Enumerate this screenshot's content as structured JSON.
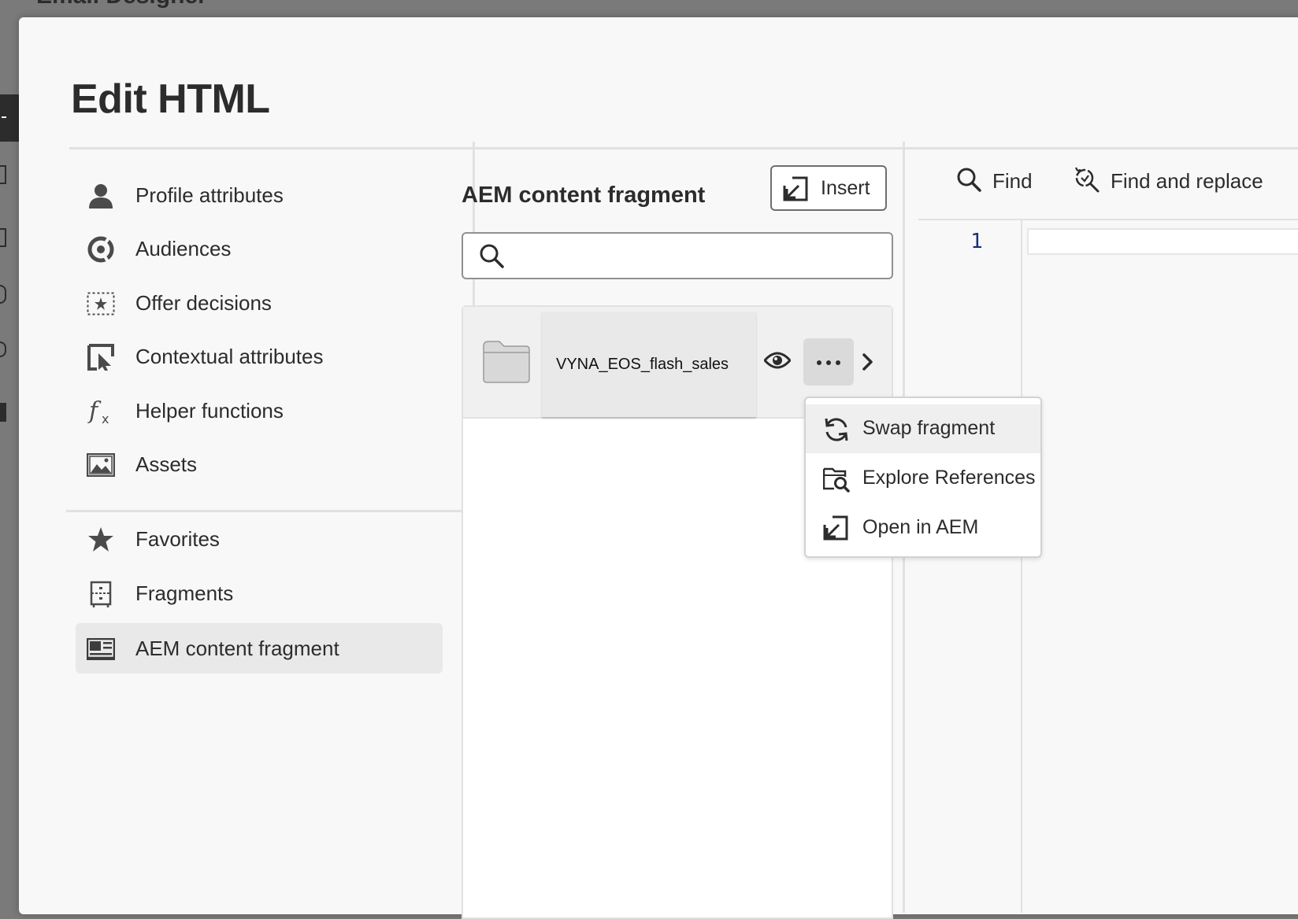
{
  "background": {
    "app_title": "Email Designer"
  },
  "modal": {
    "title": "Edit HTML"
  },
  "sidebar": {
    "items": [
      {
        "label": "Profile attributes",
        "icon": "user-icon",
        "selected": false
      },
      {
        "label": "Audiences",
        "icon": "audience-icon",
        "selected": false
      },
      {
        "label": "Offer decisions",
        "icon": "offer-icon",
        "selected": false
      },
      {
        "label": "Contextual attributes",
        "icon": "contextual-icon",
        "selected": false
      },
      {
        "label": "Helper functions",
        "icon": "function-icon",
        "selected": false
      },
      {
        "label": "Assets",
        "icon": "image-icon",
        "selected": false
      },
      {
        "label": "Favorites",
        "icon": "star-icon",
        "selected": false
      },
      {
        "label": "Fragments",
        "icon": "fragment-icon",
        "selected": false
      },
      {
        "label": "AEM content fragment",
        "icon": "content-fragment-icon",
        "selected": true
      }
    ]
  },
  "panel": {
    "title": "AEM content fragment",
    "insert_label": "Insert",
    "search": {
      "value": "",
      "placeholder": ""
    },
    "items": [
      {
        "name": "VYNA_EOS_flash_sales",
        "type": "folder"
      }
    ]
  },
  "context_menu": {
    "items": [
      {
        "label": "Swap fragment",
        "icon": "refresh-icon"
      },
      {
        "label": "Explore References",
        "icon": "folder-search-icon"
      },
      {
        "label": "Open in AEM",
        "icon": "open-external-icon"
      }
    ]
  },
  "editor": {
    "find_label": "Find",
    "find_replace_label": "Find and replace",
    "line_numbers": [
      "1"
    ]
  },
  "colors": {
    "backdrop": "#7a7a7a",
    "modal_bg": "#f8f8f8",
    "selected_bg": "#e9e9e9",
    "text": "#2c2c2c",
    "line_number": "#16307a"
  }
}
